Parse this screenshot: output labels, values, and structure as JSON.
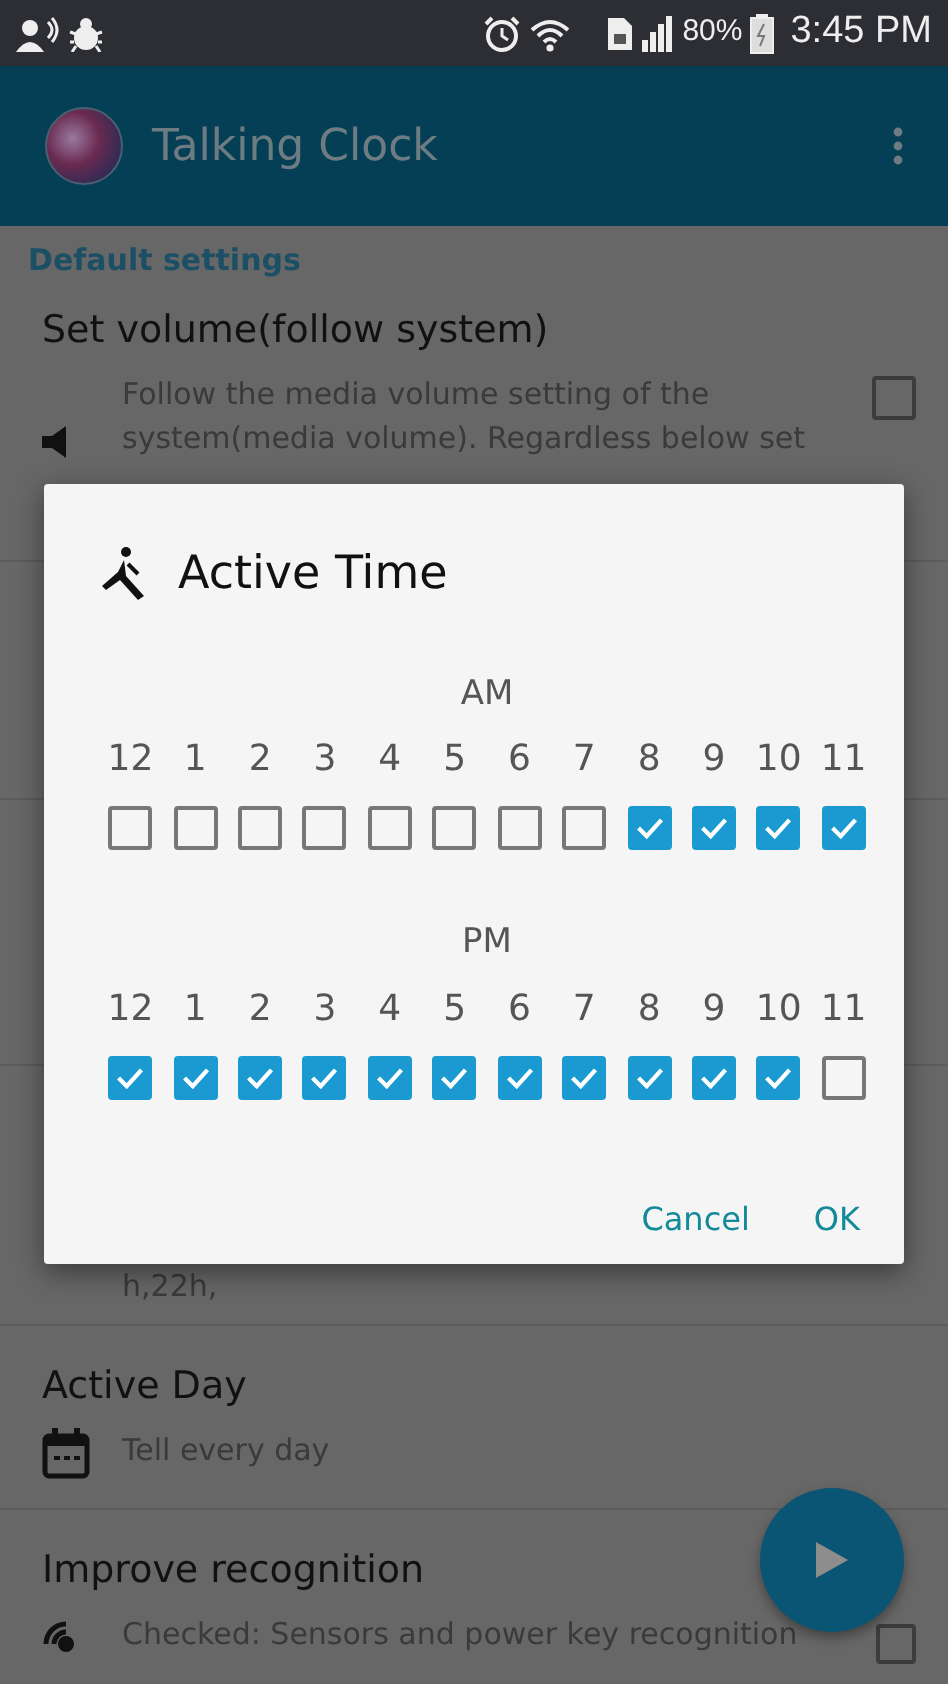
{
  "status_bar": {
    "battery": "80%",
    "time": "3:45 PM"
  },
  "app_bar": {
    "title": "Talking Clock"
  },
  "settings": {
    "section_header": "Default settings",
    "items": [
      {
        "kind": "checkbox",
        "title": "Set volume(follow system)",
        "description": "Follow the media volume setting of the system(media volume). Regardless below set",
        "checked": false
      },
      {
        "kind": "text",
        "description": "h,22h,"
      },
      {
        "kind": "text",
        "title": "Active Day",
        "description": "Tell every day"
      },
      {
        "kind": "checkbox",
        "title": "Improve recognition",
        "description": "Checked: Sensors and power key recognition",
        "checked": false
      }
    ]
  },
  "dialog": {
    "title": "Active Time",
    "groups": [
      {
        "label": "AM",
        "hours": [
          {
            "label": "12",
            "checked": false
          },
          {
            "label": "1",
            "checked": false
          },
          {
            "label": "2",
            "checked": false
          },
          {
            "label": "3",
            "checked": false
          },
          {
            "label": "4",
            "checked": false
          },
          {
            "label": "5",
            "checked": false
          },
          {
            "label": "6",
            "checked": false
          },
          {
            "label": "7",
            "checked": false
          },
          {
            "label": "8",
            "checked": true
          },
          {
            "label": "9",
            "checked": true
          },
          {
            "label": "10",
            "checked": true
          },
          {
            "label": "11",
            "checked": true
          }
        ]
      },
      {
        "label": "PM",
        "hours": [
          {
            "label": "12",
            "checked": true
          },
          {
            "label": "1",
            "checked": true
          },
          {
            "label": "2",
            "checked": true
          },
          {
            "label": "3",
            "checked": true
          },
          {
            "label": "4",
            "checked": true
          },
          {
            "label": "5",
            "checked": true
          },
          {
            "label": "6",
            "checked": true
          },
          {
            "label": "7",
            "checked": true
          },
          {
            "label": "8",
            "checked": true
          },
          {
            "label": "9",
            "checked": true
          },
          {
            "label": "10",
            "checked": true
          },
          {
            "label": "11",
            "checked": false
          }
        ]
      }
    ],
    "buttons": [
      "Cancel",
      "OK"
    ]
  }
}
